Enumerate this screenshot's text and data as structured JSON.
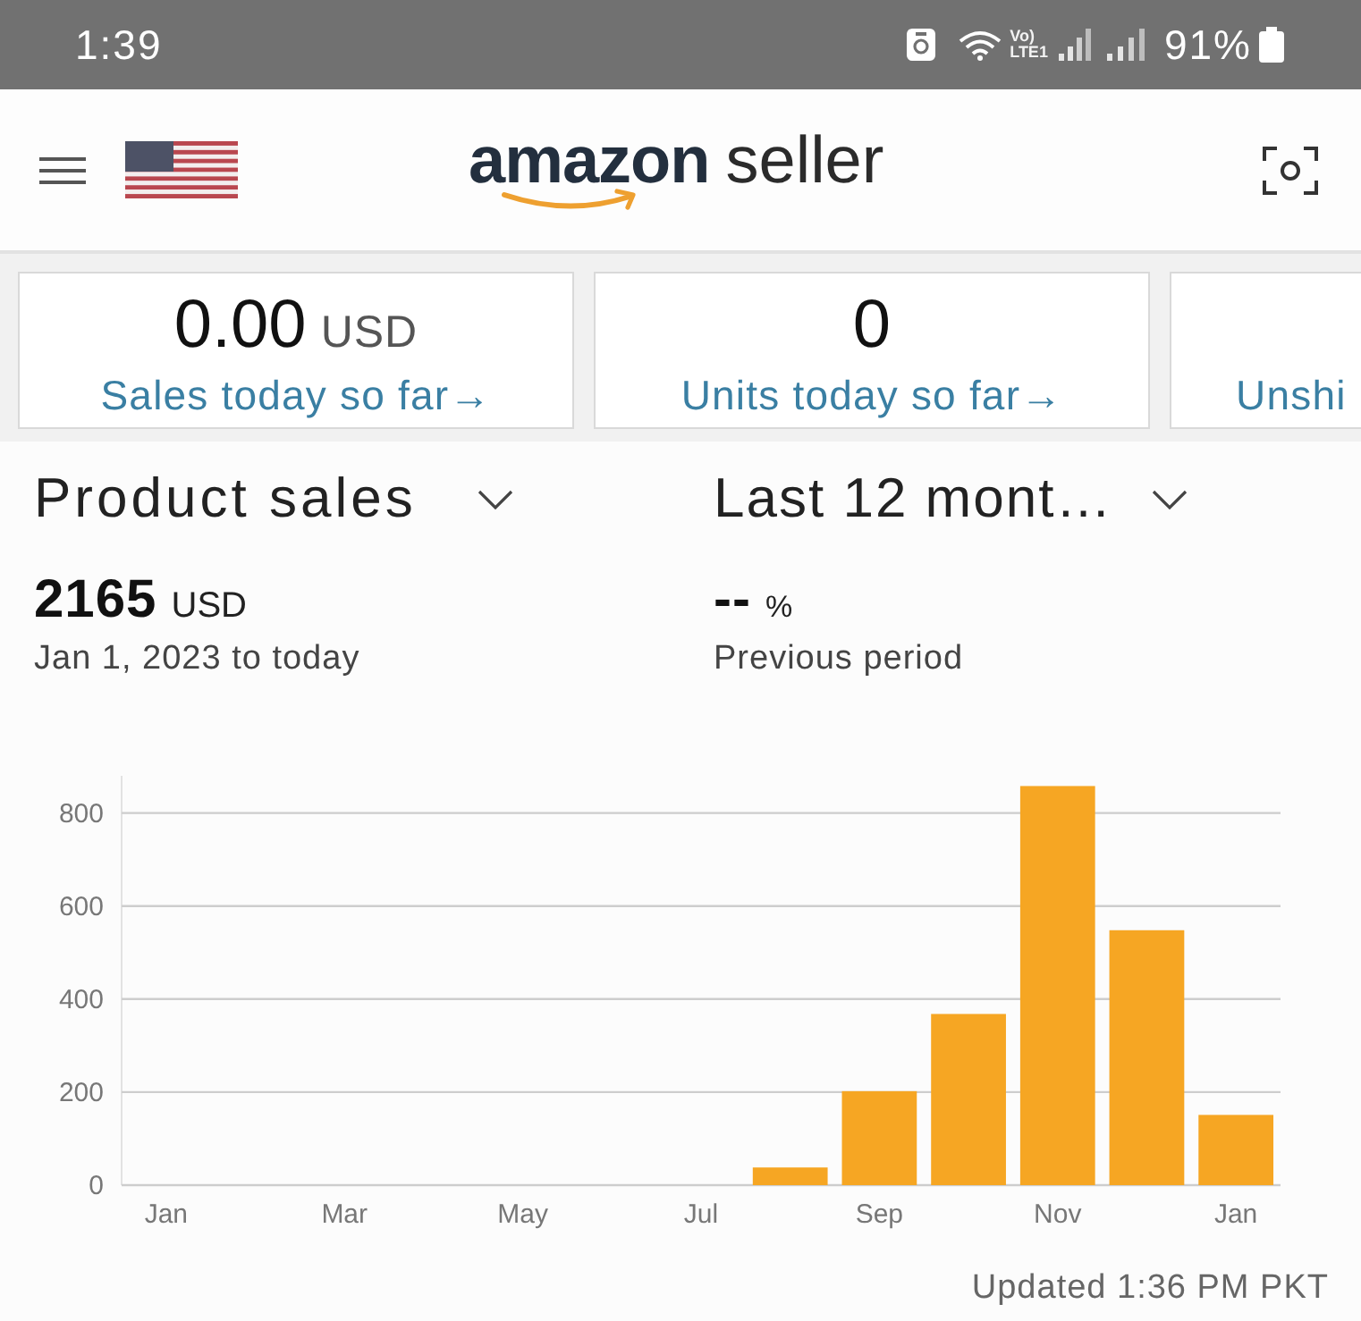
{
  "status_bar": {
    "time": "1:39",
    "volte": {
      "top": "Vo)",
      "bottom": "LTE1"
    },
    "battery_percent": "91%"
  },
  "header": {
    "logo": {
      "brand": "amazon",
      "product": "seller"
    }
  },
  "summary_cards": [
    {
      "value": "0.00",
      "unit": "USD",
      "label": "Sales today so far→"
    },
    {
      "value": "0",
      "label": "Units today so far→"
    },
    {
      "label": "Unshi"
    }
  ],
  "filters": {
    "metric": "Product sales",
    "period": "Last 12 mont…"
  },
  "totals": [
    {
      "value": "2165",
      "unit": "USD",
      "caption": "Jan 1, 2023 to today"
    },
    {
      "value": "--",
      "unit": "%",
      "caption": "Previous period"
    }
  ],
  "chart": {
    "chart_data": {
      "type": "bar",
      "categories": [
        "Jan",
        null,
        "Mar",
        null,
        "May",
        null,
        "Jul",
        null,
        "Sep",
        null,
        "Nov",
        null,
        "Jan"
      ],
      "values": [
        0,
        0,
        0,
        0,
        0,
        0,
        0,
        38,
        202,
        368,
        858,
        548,
        151
      ],
      "ylim": [
        0,
        880
      ],
      "yticks": [
        0,
        200,
        400,
        600,
        800
      ],
      "grid": true
    }
  },
  "updated": "Updated 1:36 PM PKT"
}
